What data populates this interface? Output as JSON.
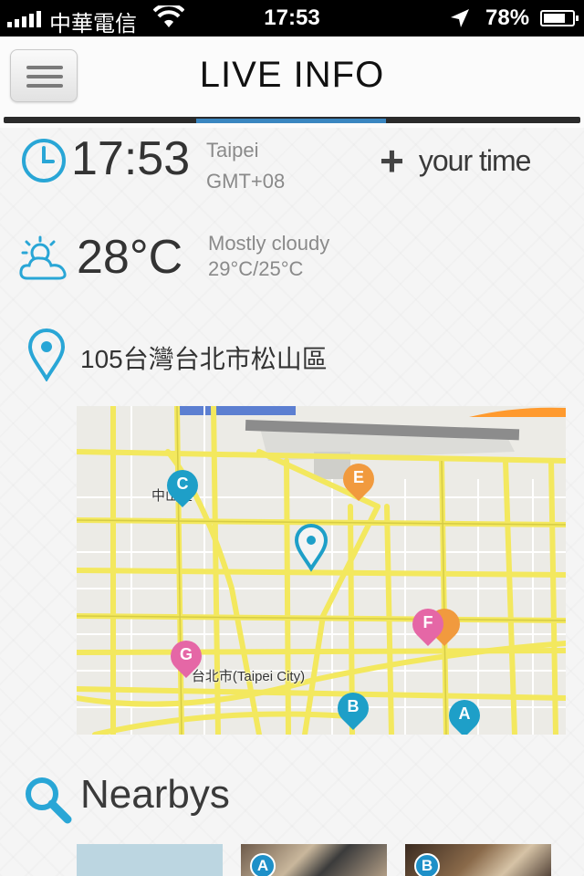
{
  "status_bar": {
    "carrier": "中華電信",
    "time": "17:53",
    "battery": "78%",
    "battery_level": 0.78
  },
  "header": {
    "title": "LIVE INFO"
  },
  "time_info": {
    "time": "17:53",
    "city": "Taipei",
    "timezone": "GMT+08",
    "add_time_label": "your time"
  },
  "weather": {
    "temperature": "28°C",
    "condition": "Mostly cloudy",
    "range": "29°C/25°C"
  },
  "location": {
    "address": "105台灣台北市松山區"
  },
  "map": {
    "labels": {
      "district_top": "中山區",
      "city": "台北市(Taipei City)"
    },
    "pins": [
      {
        "letter": "C",
        "color": "#1e9fc8"
      },
      {
        "letter": "E",
        "color": "#f19a3e"
      },
      {
        "letter": "F",
        "color": "#e567a6"
      },
      {
        "letter": "G",
        "color": "#e567a6"
      },
      {
        "letter": "B",
        "color": "#1e9fc8"
      },
      {
        "letter": "A",
        "color": "#1e9fc8"
      }
    ],
    "current_location_color": "#1e9fc8"
  },
  "nearbys": {
    "title": "Nearbys",
    "items": [
      {
        "badge": ""
      },
      {
        "badge": "A"
      },
      {
        "badge": "B"
      }
    ]
  },
  "colors": {
    "accent": "#3a86c0",
    "icon_blue": "#29a6d6"
  }
}
